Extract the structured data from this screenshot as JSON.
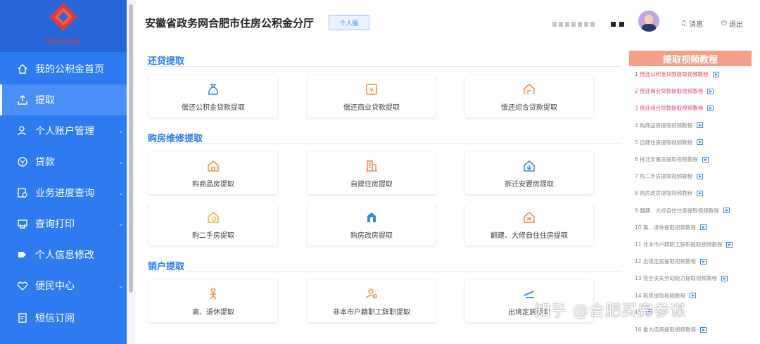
{
  "logo": {
    "text": "住房公积金"
  },
  "sidebar": {
    "items": [
      {
        "label": "我的公积金首页",
        "icon": "home-icon"
      },
      {
        "label": "提取",
        "icon": "upload-icon"
      },
      {
        "label": "个人账户管理",
        "icon": "user-icon"
      },
      {
        "label": "贷款",
        "icon": "loan-icon"
      },
      {
        "label": "业务进度查询",
        "icon": "progress-icon"
      },
      {
        "label": "查询打印",
        "icon": "print-icon"
      },
      {
        "label": "个人信息修改",
        "icon": "edit-icon"
      },
      {
        "label": "便民中心",
        "icon": "heart-icon"
      },
      {
        "label": "短信订阅",
        "icon": "sms-icon"
      }
    ]
  },
  "header": {
    "title": "安徽省政务网合肥市住房公积金分厅",
    "badge": "个人版",
    "message_label": "消息",
    "logout_label": "退出"
  },
  "sections": {
    "repay": {
      "title": "还贷提取",
      "cards": [
        {
          "label": "偿还公积金贷款提取",
          "icon": "moneybag-icon"
        },
        {
          "label": "偿还商业贷款提取",
          "icon": "yen-icon"
        },
        {
          "label": "偿还组合贷款提取",
          "icon": "combo-house-icon"
        }
      ]
    },
    "purchase": {
      "title": "购房维修提取",
      "cards": [
        {
          "label": "购商品房提取",
          "icon": "house-icon"
        },
        {
          "label": "自建住房提取",
          "icon": "building-icon"
        },
        {
          "label": "拆迁安置房提取",
          "icon": "house-arrow-icon"
        },
        {
          "label": "购二手房提取",
          "icon": "house-key-icon"
        },
        {
          "label": "购房改房提取",
          "icon": "apartment-icon"
        },
        {
          "label": "翻建、大修自住住房提取",
          "icon": "repair-house-icon"
        }
      ]
    },
    "closure": {
      "title": "销户提取",
      "cards": [
        {
          "label": "离、退休提取",
          "icon": "person-icon"
        },
        {
          "label": "非本市户籍职工辞职提取",
          "icon": "person-group-icon"
        },
        {
          "label": "出境定居提取",
          "icon": "plane-icon"
        }
      ]
    }
  },
  "tutorials": {
    "title": "提取视频教程",
    "items": [
      {
        "label": "1 偿还公积金贷款提取视频教程",
        "color": "#e0486b"
      },
      {
        "label": "2 偿还商业贷款提取视频教程",
        "color": "#e0486b"
      },
      {
        "label": "3 偿还组合贷款提取视频教程",
        "color": "#e0486b"
      },
      {
        "label": "4 购商品房提取视频教程",
        "color": "#888888"
      },
      {
        "label": "5 自建住房提取视频教程",
        "color": "#888888"
      },
      {
        "label": "6 拆迁安置房提取视频教程",
        "color": "#888888"
      },
      {
        "label": "7 购二手房提取视频教程",
        "color": "#888888"
      },
      {
        "label": "8 购房改房提取视频教程",
        "color": "#888888"
      },
      {
        "label": "9 翻建、大修自住住房提取视频教程",
        "color": "#888888"
      },
      {
        "label": "10 离、退休提取视频教程",
        "color": "#888888"
      },
      {
        "label": "11 非本市户籍职工辞职提取视频教程",
        "color": "#888888"
      },
      {
        "label": "12 出境定居提取视频教程",
        "color": "#888888"
      },
      {
        "label": "13 完全丧失劳动能力提取视频教程",
        "color": "#888888"
      },
      {
        "label": "14 租房提取视频教程",
        "color": "#888888"
      },
      {
        "label": "15",
        "color": "#888888"
      },
      {
        "label": "16 重大疾病提取视频教程",
        "color": "#888888"
      }
    ]
  },
  "watermark": "知乎 @合肥买房参谋",
  "colors": {
    "sidebar": "#2e7af0",
    "accent": "#2e7af0",
    "tutorial_header": "#f3a089",
    "card_icon": "#f08a4b"
  }
}
